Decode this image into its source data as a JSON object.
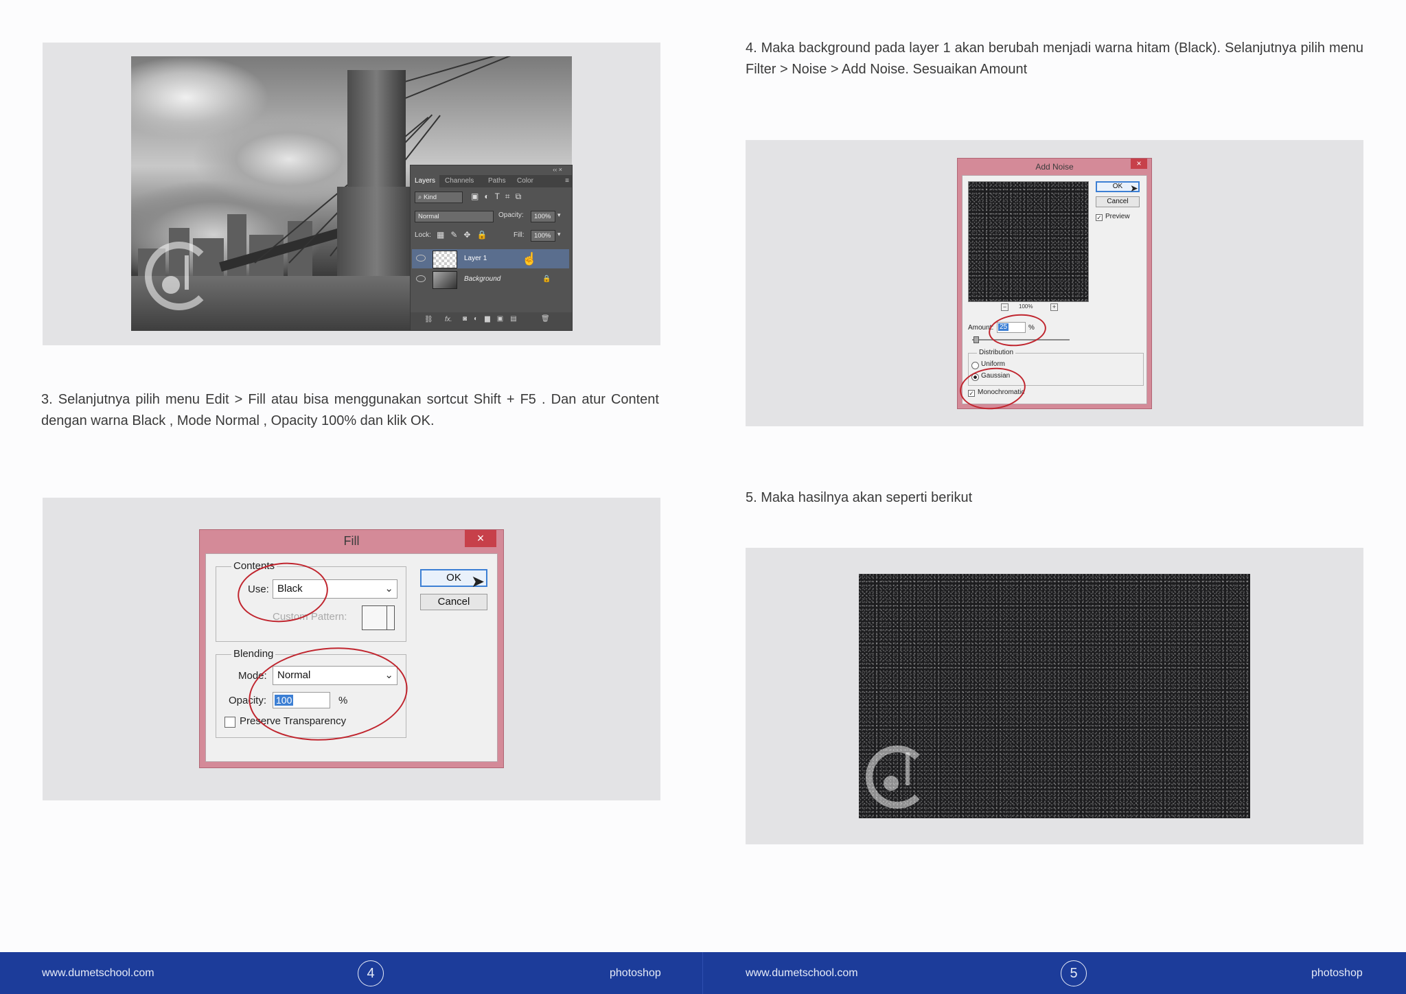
{
  "page_left": {
    "step3_text": "3. Selanjutnya pilih menu Edit > Fill atau bisa menggunakan sortcut Shift + F5 . Dan atur Content dengan warna Black , Mode Normal , Opacity 100% dan klik OK.",
    "layers_panel": {
      "tabs": [
        "Layers",
        "Channels",
        "Paths",
        "Color"
      ],
      "filter": "Kind",
      "blend_mode": "Normal",
      "opacity_label": "Opacity:",
      "opacity_value": "100%",
      "lock_label": "Lock:",
      "fill_label": "Fill:",
      "fill_value": "100%",
      "layers": [
        "Layer 1",
        "Background"
      ],
      "fx_label": "fx."
    },
    "fill_dialog": {
      "title": "Fill",
      "close": "×",
      "contents_legend": "Contents",
      "use_label": "Use:",
      "use_value": "Black",
      "custom_pattern_label": "Custom Pattern:",
      "blending_legend": "Blending",
      "mode_label": "Mode:",
      "mode_value": "Normal",
      "opacity_label": "Opacity:",
      "opacity_value": "100",
      "percent": "%",
      "preserve_label": "Preserve Transparency",
      "ok": "OK",
      "cancel": "Cancel"
    }
  },
  "page_right": {
    "step4_text": "4. Maka background pada layer 1 akan berubah menjadi warna hitam (Black). Selanjutnya pilih menu Filter > Noise > Add Noise. Sesuaikan Amount",
    "add_noise_dialog": {
      "title": "Add Noise",
      "close": "×",
      "ok": "OK",
      "cancel": "Cancel",
      "preview_label": "Preview",
      "zoom": "100%",
      "zoom_out": "−",
      "zoom_in": "+",
      "amount_label": "Amount:",
      "amount_value": "25",
      "percent": "%",
      "distribution_legend": "Distribution",
      "uniform_label": "Uniform",
      "gaussian_label": "Gaussian",
      "monochromatic_label": "Monochromatic"
    },
    "step5_text": "5. Maka hasilnya akan seperti berikut"
  },
  "footer": {
    "left_site": "www.dumetschool.com",
    "left_page": "4",
    "left_topic": "photoshop",
    "right_site": "www.dumetschool.com",
    "right_page": "5",
    "right_topic": "photoshop"
  },
  "colors": {
    "footer_bg": "#1c3c9a",
    "frame_bg": "#e3e3e5",
    "dialog_border": "#d48a98",
    "annotation_ring": "#c0252e"
  }
}
